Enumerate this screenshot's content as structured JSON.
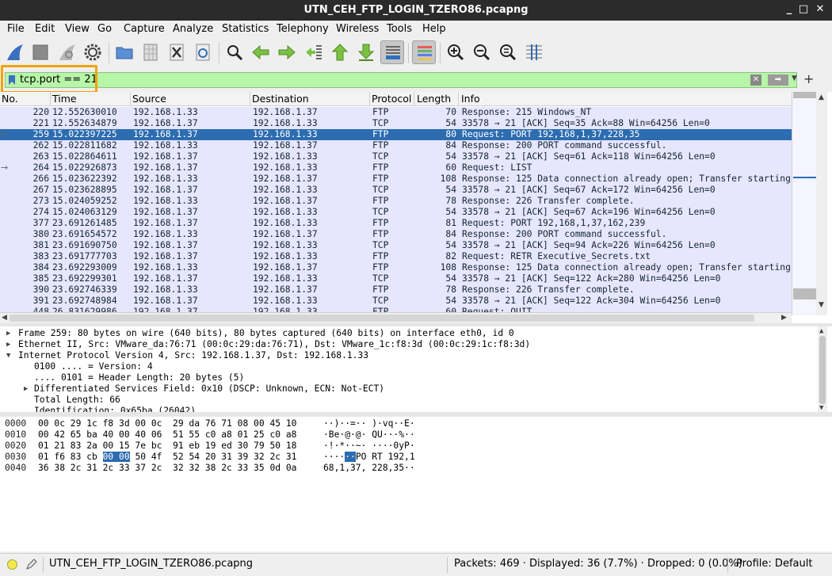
{
  "window": {
    "title": "UTN_CEH_FTP_LOGIN_TZERO86.pcapng",
    "controls": [
      "_",
      "□",
      "✕"
    ]
  },
  "menu": [
    "File",
    "Edit",
    "View",
    "Go",
    "Capture",
    "Analyze",
    "Statistics",
    "Telephony",
    "Wireless",
    "Tools",
    "Help"
  ],
  "filter": {
    "value": "tcp.port == 21",
    "highlight_color": "#f0a30a",
    "bg_color": "#b7f5a7"
  },
  "columns": [
    "No.",
    "Time",
    "Source",
    "Destination",
    "Protocol",
    "Length",
    "Info"
  ],
  "packets": [
    {
      "no": "220",
      "time": "12.552630010",
      "src": "192.168.1.33",
      "dst": "192.168.1.37",
      "proto": "FTP",
      "len": "70",
      "info": "Response: 215 Windows_NT"
    },
    {
      "no": "221",
      "time": "12.552634879",
      "src": "192.168.1.37",
      "dst": "192.168.1.33",
      "proto": "TCP",
      "len": "54",
      "info": "33578 → 21 [ACK] Seq=35 Ack=88 Win=64256 Len=0"
    },
    {
      "no": "259",
      "time": "15.022397225",
      "src": "192.168.1.37",
      "dst": "192.168.1.33",
      "proto": "FTP",
      "len": "80",
      "info": "Request: PORT 192,168,1,37,228,35",
      "selected": true
    },
    {
      "no": "262",
      "time": "15.022811682",
      "src": "192.168.1.33",
      "dst": "192.168.1.37",
      "proto": "FTP",
      "len": "84",
      "info": "Response: 200 PORT command successful."
    },
    {
      "no": "263",
      "time": "15.022864611",
      "src": "192.168.1.37",
      "dst": "192.168.1.33",
      "proto": "TCP",
      "len": "54",
      "info": "33578 → 21 [ACK] Seq=61 Ack=118 Win=64256 Len=0"
    },
    {
      "no": "264",
      "time": "15.022926873",
      "src": "192.168.1.37",
      "dst": "192.168.1.33",
      "proto": "FTP",
      "len": "60",
      "info": "Request: LIST"
    },
    {
      "no": "266",
      "time": "15.023622392",
      "src": "192.168.1.33",
      "dst": "192.168.1.37",
      "proto": "FTP",
      "len": "108",
      "info": "Response: 125 Data connection already open; Transfer starting."
    },
    {
      "no": "267",
      "time": "15.023628895",
      "src": "192.168.1.37",
      "dst": "192.168.1.33",
      "proto": "TCP",
      "len": "54",
      "info": "33578 → 21 [ACK] Seq=67 Ack=172 Win=64256 Len=0"
    },
    {
      "no": "273",
      "time": "15.024059252",
      "src": "192.168.1.33",
      "dst": "192.168.1.37",
      "proto": "FTP",
      "len": "78",
      "info": "Response: 226 Transfer complete."
    },
    {
      "no": "274",
      "time": "15.024063129",
      "src": "192.168.1.37",
      "dst": "192.168.1.33",
      "proto": "TCP",
      "len": "54",
      "info": "33578 → 21 [ACK] Seq=67 Ack=196 Win=64256 Len=0"
    },
    {
      "no": "377",
      "time": "23.691261485",
      "src": "192.168.1.37",
      "dst": "192.168.1.33",
      "proto": "FTP",
      "len": "81",
      "info": "Request: PORT 192,168,1,37,162,239"
    },
    {
      "no": "380",
      "time": "23.691654572",
      "src": "192.168.1.33",
      "dst": "192.168.1.37",
      "proto": "FTP",
      "len": "84",
      "info": "Response: 200 PORT command successful."
    },
    {
      "no": "381",
      "time": "23.691690750",
      "src": "192.168.1.37",
      "dst": "192.168.1.33",
      "proto": "TCP",
      "len": "54",
      "info": "33578 → 21 [ACK] Seq=94 Ack=226 Win=64256 Len=0"
    },
    {
      "no": "383",
      "time": "23.691777703",
      "src": "192.168.1.37",
      "dst": "192.168.1.33",
      "proto": "FTP",
      "len": "82",
      "info": "Request: RETR Executive_Secrets.txt"
    },
    {
      "no": "384",
      "time": "23.692293009",
      "src": "192.168.1.33",
      "dst": "192.168.1.37",
      "proto": "FTP",
      "len": "108",
      "info": "Response: 125 Data connection already open; Transfer starting."
    },
    {
      "no": "385",
      "time": "23.692299301",
      "src": "192.168.1.37",
      "dst": "192.168.1.33",
      "proto": "TCP",
      "len": "54",
      "info": "33578 → 21 [ACK] Seq=122 Ack=280 Win=64256 Len=0"
    },
    {
      "no": "390",
      "time": "23.692746339",
      "src": "192.168.1.33",
      "dst": "192.168.1.37",
      "proto": "FTP",
      "len": "78",
      "info": "Response: 226 Transfer complete."
    },
    {
      "no": "391",
      "time": "23.692748984",
      "src": "192.168.1.37",
      "dst": "192.168.1.33",
      "proto": "TCP",
      "len": "54",
      "info": "33578 → 21 [ACK] Seq=122 Ack=304 Win=64256 Len=0"
    },
    {
      "no": "448",
      "time": "26.831629986",
      "src": "192.168.1.37",
      "dst": "192.168.1.33",
      "proto": "FTP",
      "len": "60",
      "info": "Request: QUIT"
    }
  ],
  "details": [
    {
      "text": "Frame 259: 80 bytes on wire (640 bits), 80 bytes captured (640 bits) on interface eth0, id 0",
      "indent": 0,
      "tree": "collapsed"
    },
    {
      "text": "Ethernet II, Src: VMware_da:76:71 (00:0c:29:da:76:71), Dst: VMware_1c:f8:3d (00:0c:29:1c:f8:3d)",
      "indent": 0,
      "tree": "collapsed"
    },
    {
      "text": "Internet Protocol Version 4, Src: 192.168.1.37, Dst: 192.168.1.33",
      "indent": 0,
      "tree": "expanded"
    },
    {
      "text": "0100 .... = Version: 4",
      "indent": 1,
      "tree": "none"
    },
    {
      "text": ".... 0101 = Header Length: 20 bytes (5)",
      "indent": 1,
      "tree": "none"
    },
    {
      "text": "Differentiated Services Field: 0x10 (DSCP: Unknown, ECN: Not-ECT)",
      "indent": 1,
      "tree": "collapsed"
    },
    {
      "text": "Total Length: 66",
      "indent": 1,
      "tree": "none"
    },
    {
      "text": "Identification: 0x65ba (26042)",
      "indent": 1,
      "tree": "none"
    }
  ],
  "hex": [
    {
      "offset": "0000",
      "pre": "00 0c 29 1c f8 3d 00 0c  29 da 76 71 08 00 45 10",
      "hl": "",
      "post": "",
      "apre": "··)··=·· )·vq··E·",
      "ahl": "",
      "apost": ""
    },
    {
      "offset": "0010",
      "pre": "00 42 65 ba 40 00 40 06  51 55 c0 a8 01 25 c0 a8",
      "hl": "",
      "post": "",
      "apre": "·Be·@·@· QU···%··",
      "ahl": "",
      "apost": ""
    },
    {
      "offset": "0020",
      "pre": "01 21 83 2a 00 15 7e bc  91 eb 19 ed 30 79 50 18",
      "hl": "",
      "post": "",
      "apre": "·!·*··~· ····0yP·",
      "ahl": "",
      "apost": ""
    },
    {
      "offset": "0030",
      "pre": "01 f6 83 cb ",
      "hl": "00 00",
      "post": " 50 4f  52 54 20 31 39 32 2c 31",
      "apre": "····",
      "ahl": "··",
      "apost": "PO RT 192,1"
    },
    {
      "offset": "0040",
      "pre": "36 38 2c 31 2c 33 37 2c  32 32 38 2c 33 35 0d 0a",
      "hl": "",
      "post": "",
      "apre": "68,1,37, 228,35··",
      "ahl": "",
      "apost": ""
    }
  ],
  "status": {
    "file": "UTN_CEH_FTP_LOGIN_TZERO86.pcapng",
    "packets": "Packets: 469 · Displayed: 36 (7.7%) · Dropped: 0 (0.0%)",
    "profile": "Profile: Default"
  },
  "colors": {
    "row_bg": "#e7e6ff",
    "selected_bg": "#2c6cb0",
    "filter_ok": "#b7f5a7"
  }
}
